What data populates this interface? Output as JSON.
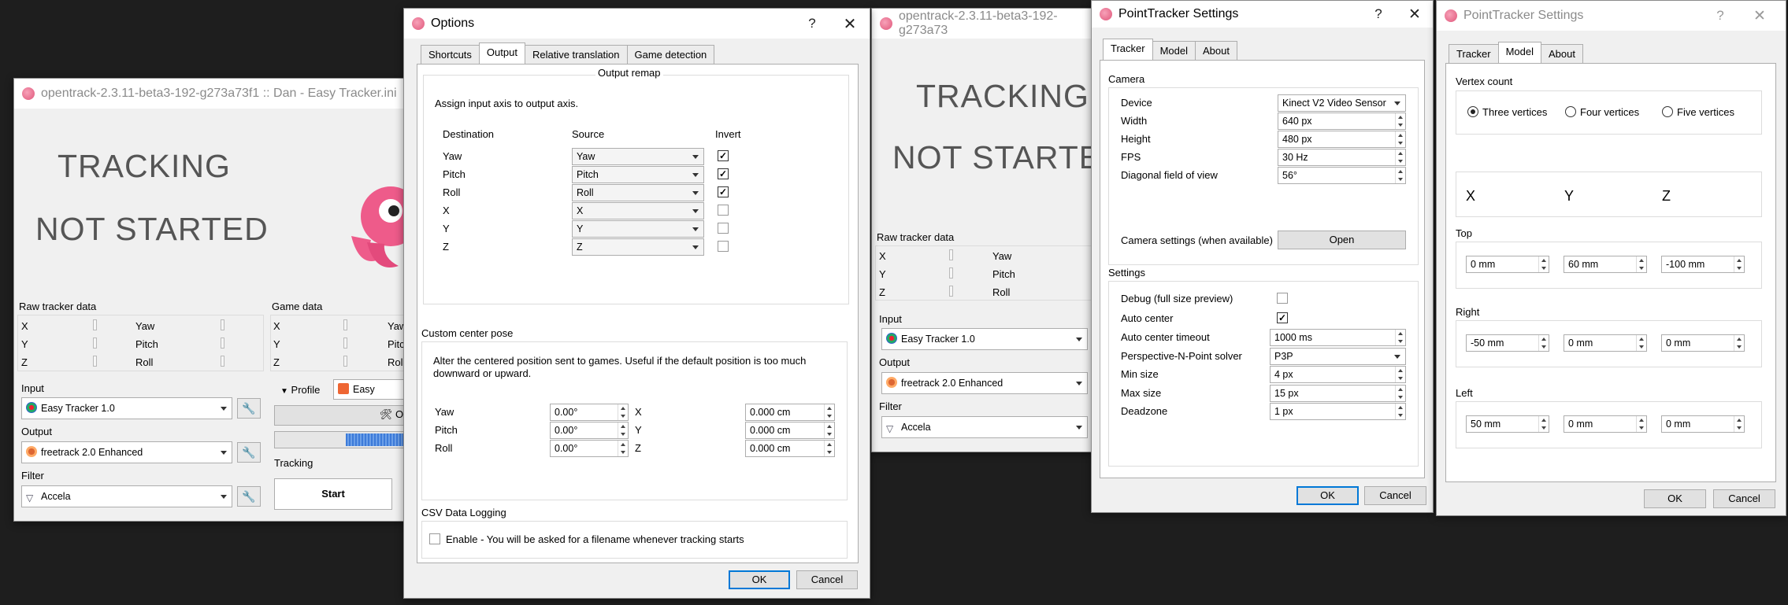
{
  "main": {
    "title": "opentrack-2.3.11-beta3-192-g273a73f1 :: Dan - Easy Tracker.ini",
    "status_line1": "TRACKING",
    "status_line2": "NOT STARTED",
    "raw_label": "Raw tracker data",
    "raw_rows": [
      "X",
      "Y",
      "Z"
    ],
    "raw_rot": [
      "Yaw",
      "Pitch",
      "Roll"
    ],
    "game_label": "Game data",
    "game_rows": [
      "X",
      "Y",
      "Z"
    ],
    "game_rot": [
      "Yaw",
      "Pitch",
      "Roll"
    ],
    "profile_label": "Profile",
    "profile_value": "Easy",
    "options_label": "Opt",
    "input_label": "Input",
    "input_value": "Easy Tracker 1.0",
    "output_label": "Output",
    "output_value": "freetrack 2.0 Enhanced",
    "filter_label": "Filter",
    "filter_value": "Accela",
    "tracking_label": "Tracking",
    "start_label": "Start"
  },
  "options": {
    "title": "Options",
    "tabs": [
      "Shortcuts",
      "Output",
      "Relative translation",
      "Game detection"
    ],
    "remap_title": "Output remap",
    "remap_desc": "Assign input axis to output axis.",
    "col_dest": "Destination",
    "col_src": "Source",
    "col_inv": "Invert",
    "rows": [
      {
        "dest": "Yaw",
        "src": "Yaw",
        "inv": "✓"
      },
      {
        "dest": "Pitch",
        "src": "Pitch",
        "inv": "✓"
      },
      {
        "dest": "Roll",
        "src": "Roll",
        "inv": "✓"
      },
      {
        "dest": "X",
        "src": "X",
        "inv": ""
      },
      {
        "dest": "Y",
        "src": "Y",
        "inv": ""
      },
      {
        "dest": "Z",
        "src": "Z",
        "inv": ""
      }
    ],
    "center_title": "Custom center pose",
    "center_desc": "Alter the centered position sent to games. Useful if the default position is too much downward or upward.",
    "center_rows": [
      {
        "rot": "Yaw",
        "rot_val": "0.00°",
        "pos": "X",
        "pos_val": "0.000 cm"
      },
      {
        "rot": "Pitch",
        "rot_val": "0.00°",
        "pos": "Y",
        "pos_val": "0.000 cm"
      },
      {
        "rot": "Roll",
        "rot_val": "0.00°",
        "pos": "Z",
        "pos_val": "0.000 cm"
      }
    ],
    "csv_title": "CSV Data Logging",
    "csv_enable": "Enable - You will be asked for a filename whenever tracking starts",
    "ok": "OK",
    "cancel": "Cancel"
  },
  "main2": {
    "title": "opentrack-2.3.11-beta3-192-g273a73",
    "status_line1": "TRACKING",
    "status_line2": "NOT STARTE",
    "raw_label": "Raw tracker data",
    "raw_rows": [
      "X",
      "Y",
      "Z"
    ],
    "raw_rot": [
      "Yaw",
      "Pitch",
      "Roll"
    ],
    "input_label": "Input",
    "input_value": "Easy Tracker 1.0",
    "output_label": "Output",
    "output_value": "freetrack 2.0 Enhanced",
    "filter_label": "Filter",
    "filter_value": "Accela"
  },
  "pt1": {
    "title": "PointTracker Settings",
    "tabs": [
      "Tracker",
      "Model",
      "About"
    ],
    "camera_title": "Camera",
    "cam_rows": [
      {
        "label": "Device",
        "value": "Kinect V2 Video Sensor",
        "kind": "combo"
      },
      {
        "label": "Width",
        "value": "640 px",
        "kind": "spin"
      },
      {
        "label": "Height",
        "value": "480 px",
        "kind": "spin"
      },
      {
        "label": "FPS",
        "value": "30 Hz",
        "kind": "spin"
      },
      {
        "label": "Diagonal field of view",
        "value": "56°",
        "kind": "spin"
      }
    ],
    "cam_settings_label": "Camera settings (when available)",
    "open_label": "Open",
    "settings_title": "Settings",
    "debug_label": "Debug (full size preview)",
    "autocenter_label": "Auto center",
    "autocenter_check": "✓",
    "set_rows": [
      {
        "label": "Auto center timeout",
        "value": "1000 ms",
        "kind": "spin"
      },
      {
        "label": "Perspective-N-Point solver",
        "value": "P3P",
        "kind": "combo"
      },
      {
        "label": "Min size",
        "value": "4 px",
        "kind": "spin"
      },
      {
        "label": "Max size",
        "value": "15 px",
        "kind": "spin"
      },
      {
        "label": "Deadzone",
        "value": "1 px",
        "kind": "spin"
      }
    ],
    "ok": "OK",
    "cancel": "Cancel"
  },
  "pt2": {
    "title": "PointTracker Settings",
    "tabs": [
      "Tracker",
      "Model",
      "About"
    ],
    "vertex_title": "Vertex count",
    "radios": [
      "Three vertices",
      "Four vertices",
      "Five vertices"
    ],
    "axes": [
      "X",
      "Y",
      "Z"
    ],
    "top_title": "Top",
    "top_vals": [
      "0 mm",
      "60 mm",
      "-100 mm"
    ],
    "right_title": "Right",
    "right_vals": [
      "-50 mm",
      "0 mm",
      "0 mm"
    ],
    "left_title": "Left",
    "left_vals": [
      "50 mm",
      "0 mm",
      "0 mm"
    ],
    "ok": "OK",
    "cancel": "Cancel"
  },
  "colors": {
    "accent": "#0078d7",
    "desktop": "#1e1e1e"
  }
}
